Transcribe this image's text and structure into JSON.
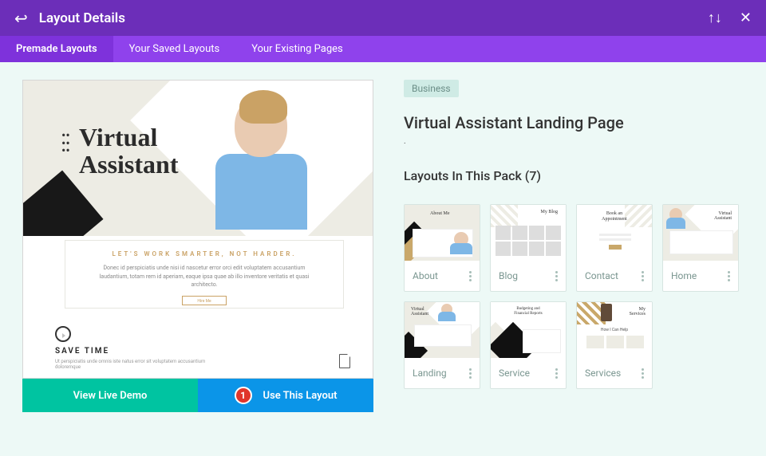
{
  "header": {
    "title": "Layout Details"
  },
  "tabs": {
    "premade": "Premade Layouts",
    "saved": "Your Saved Layouts",
    "existing": "Your Existing Pages"
  },
  "preview": {
    "heading_l1": "Virtual",
    "heading_l2": "Assistant",
    "tagline": "LET'S WORK SMARTER, NOT HARDER.",
    "desc": "Donec id perspiciatis unde nisi id nascetur error orci edit voluptatem accusantium laudantium, totam rem id aperiam, eaque ipsa quae ab illo inventore veritatis et quasi architecto.",
    "hire_btn": "Hire Me",
    "save_title": "SAVE TIME",
    "save_desc": "Ut perspiciatis unde omnis iste natus error sit voluptatem accusantium doloremque"
  },
  "actions": {
    "live_demo": "View Live Demo",
    "use_layout": "Use This Layout",
    "badge": "1"
  },
  "details": {
    "category": "Business",
    "title": "Virtual Assistant Landing Page",
    "dot": ".",
    "pack_heading": "Layouts In This Pack (7)"
  },
  "cards": {
    "about": {
      "label": "About",
      "thumb": "About Me"
    },
    "blog": {
      "label": "Blog",
      "thumb": "My Blog"
    },
    "contact": {
      "label": "Contact",
      "thumb_l1": "Book an",
      "thumb_l2": "Appointment"
    },
    "home": {
      "label": "Home",
      "thumb_l1": "Virtual",
      "thumb_l2": "Assistant"
    },
    "landing": {
      "label": "Landing",
      "thumb_l1": "Virtual",
      "thumb_l2": "Assistant"
    },
    "service": {
      "label": "Service",
      "thumb_l1": "Budgeting and",
      "thumb_l2": "Financial Reports"
    },
    "services": {
      "label": "Services",
      "thumb_l1": "My",
      "thumb_l2": "Services",
      "caption": "How I Can Help"
    }
  }
}
